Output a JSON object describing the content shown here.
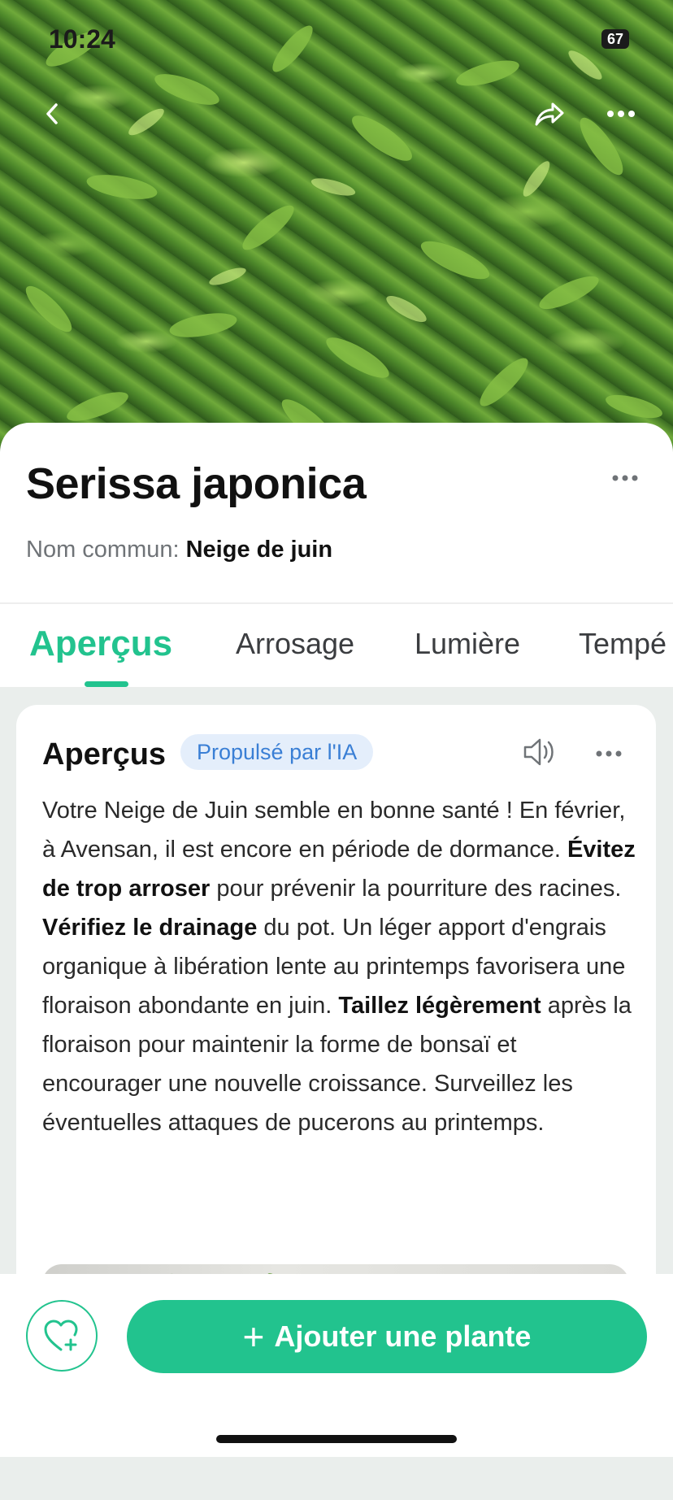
{
  "status_bar": {
    "time": "10:24",
    "battery": "67"
  },
  "hero": {
    "back_icon": "chevron-left-icon",
    "share_icon": "share-icon",
    "more_icon": "ellipsis-icon"
  },
  "plant": {
    "scientific_name": "Serissa japonica",
    "common_label": "Nom commun:",
    "common_name": "Neige de juin"
  },
  "tabs": [
    {
      "label": "Aperçus",
      "active": true
    },
    {
      "label": "Arrosage",
      "active": false
    },
    {
      "label": "Lumière",
      "active": false
    },
    {
      "label": "Tempé",
      "active": false
    }
  ],
  "card": {
    "title": "Aperçus",
    "badge": "Propulsé par l'IA",
    "text_1": "Votre Neige de Juin semble en bonne santé !  En février, à Avensan, il est encore en période de dormance.  ",
    "bold_1": "Évitez de trop arroser",
    "text_2": " pour prévenir la pourriture des racines. ",
    "bold_2": "Vérifiez le drainage",
    "text_3": " du pot.  Un léger apport d'engrais organique à libération lente au printemps favorisera une floraison abondante en juin.  ",
    "bold_3": "Taillez légèrement",
    "text_4": " après la floraison pour maintenir la forme de bonsaï et encourager une nouvelle croissance. Surveillez les éventuelles attaques de pucerons au printemps."
  },
  "bottom": {
    "add_label": "Ajouter une plante",
    "add_plus": "+"
  },
  "colors": {
    "accent": "#22c38e",
    "badge_bg": "#e4eefb",
    "badge_text": "#3a7fd5"
  }
}
